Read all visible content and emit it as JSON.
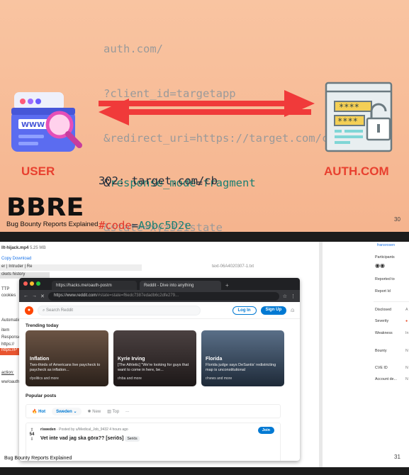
{
  "slide1": {
    "request_lines": {
      "l1": "auth.com/",
      "l2": "?client_id=targetapp",
      "l3": "&redirect_uri=https://target.com/cb",
      "l4_prefix": "&",
      "l4_key": "response_mode",
      "l4_eq": "=",
      "l4_val": "fragment",
      "l5": "&state=xyz321state"
    },
    "response_lines": {
      "l1": "302: target.com/cb",
      "l2_key": "#code",
      "l2_eq": "=",
      "l2_val": "A9bc5D2e",
      "l3_prefix": "&",
      "l3_key": "state",
      "l3_eq": "=",
      "l3_val": "xyz321state"
    },
    "user_label": "USER",
    "auth_label": "AUTH.COM",
    "browser_icon_text": "WWW",
    "auth_icon_text": "****",
    "logo_big": "BBRE",
    "logo_small": "Bug Bounty Reports Explained",
    "page_number": "30"
  },
  "slide2": {
    "doc": {
      "file_line": "llt-hijack.mp4",
      "file_size": "5.25 MB",
      "copy_download": "Copy  Download",
      "menu": "er | Intruder | Re",
      "history": "ckets history",
      "left_labels": [
        "TTP",
        "cookies",
        "Automatica",
        "item",
        "Response",
        "https://",
        "https://P",
        "action:",
        "ww/oauth"
      ],
      "right_file": "text-06A4020307-1.txt"
    },
    "browser": {
      "tab1": "https://hacks.me/oauth-postm",
      "tab2": "Reddit - Dive into anything",
      "url_host": "https://www.reddit.com",
      "url_rest": "/#state=state=f6edc7387edadb6c2dfe279...",
      "search_placeholder": "Search Reddit",
      "login": "Log In",
      "signup": "Sign Up",
      "trending_title": "Trending today",
      "cards": [
        {
          "title": "Inflation",
          "desc": "Two-thirds of Americans live paycheck to paycheck as inflation...",
          "sub": "r/politics and more",
          "color": "#4a3a2e"
        },
        {
          "title": "Kyrie Irving",
          "desc": "[The Athletic] \"We're looking for guys that want to come in here, be...",
          "sub": "r/nba and more",
          "color": "#2f2a2a"
        },
        {
          "title": "Florida",
          "desc": "Florida judge says DeSantis' redistricting map is unconstitutional",
          "sub": "r/news and more",
          "color": "#3c4e63"
        }
      ],
      "popular": "Popular posts",
      "sort": {
        "hot": "Hot",
        "region": "Sweden",
        "new": "New",
        "top": "Top",
        "more": "..."
      },
      "post": {
        "votes": "54",
        "sub": "r/sweden",
        "posted_by": "Posted by u/Medical_Job_9432 4 hours ago",
        "title": "Vet inte vad jag ska göra?? [seriös]",
        "flair": "Seriös",
        "join": "Join"
      }
    },
    "side": {
      "user": "fransrosen",
      "participants": "Participants",
      "reported_to": "Reported to",
      "report_id": "Report Id",
      "disclosed": "Disclosed",
      "severity": "Severity",
      "weakness": "Weakness",
      "bounty": "Bounty",
      "cve": "CVE ID",
      "account": "Account de...",
      "disclosed_val": "A",
      "severity_val": "",
      "weakness_val": "In",
      "bounty_val": "N",
      "cve_val": "N",
      "account_val": "N"
    },
    "logo_small": "Bug Bounty Reports Explained",
    "page_number": "31"
  }
}
